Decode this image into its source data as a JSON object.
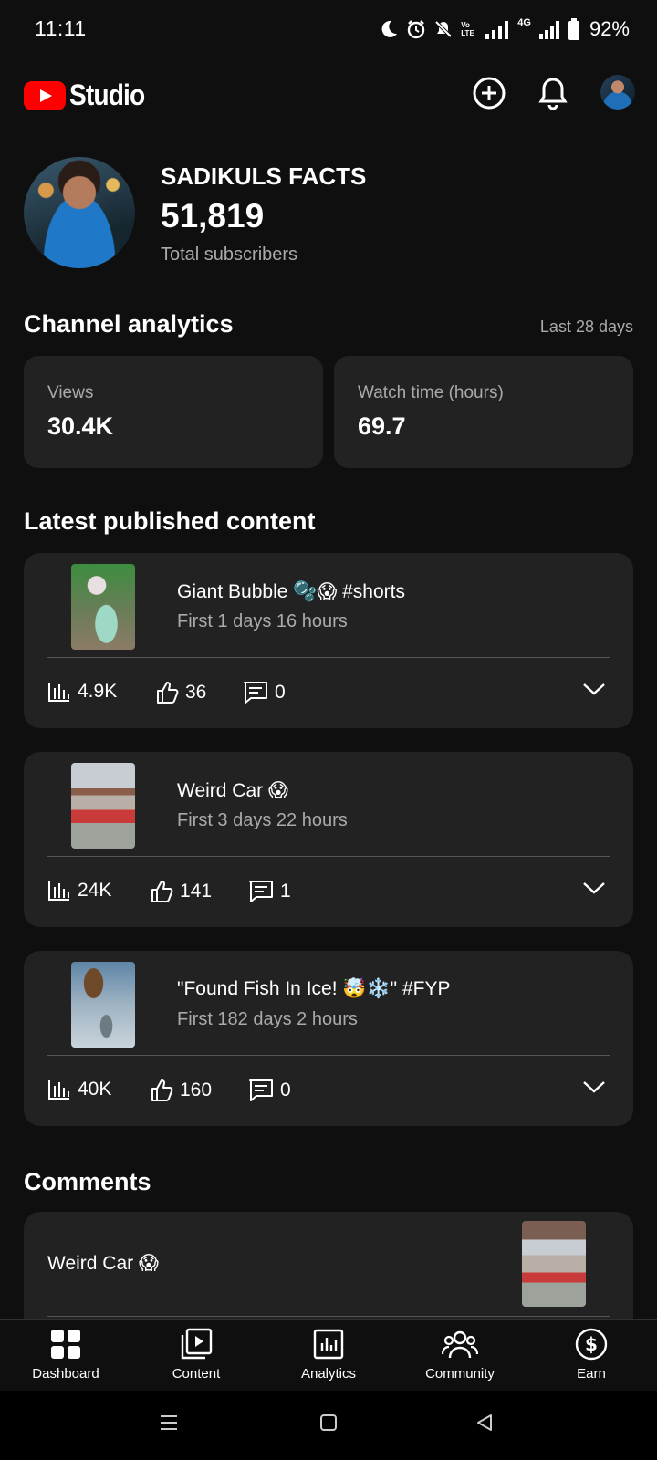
{
  "status_bar": {
    "time": "11:11",
    "battery": "92%",
    "network": "4G",
    "volte": "Vo LTE"
  },
  "header": {
    "app_name": "Studio",
    "icons": [
      "create-icon",
      "bell-icon",
      "account-avatar"
    ]
  },
  "channel": {
    "name": "SADIKULS FACTS",
    "subscribers": "51,819",
    "subscribers_label": "Total subscribers"
  },
  "analytics": {
    "title": "Channel analytics",
    "period": "Last 28 days",
    "views_label": "Views",
    "views_value": "30.4K",
    "watch_label": "Watch time (hours)",
    "watch_value": "69.7"
  },
  "latest": {
    "title": "Latest published content",
    "items": [
      {
        "title": "Giant Bubble 🫧😱 #shorts",
        "age": "First 1 days 16 hours",
        "views": "4.9K",
        "likes": "36",
        "comments": "0"
      },
      {
        "title": "Weird Car 😱",
        "age": "First 3 days 22 hours",
        "views": "24K",
        "likes": "141",
        "comments": "1"
      },
      {
        "title": "\"Found Fish In Ice! 🤯❄️\" #FYP",
        "age": "First 182 days 2 hours",
        "views": "40K",
        "likes": "160",
        "comments": "0"
      }
    ]
  },
  "comments": {
    "title": "Comments",
    "video_title": "Weird Car 😱"
  },
  "nav": {
    "items": [
      {
        "label": "Dashboard",
        "icon": "dashboard-icon"
      },
      {
        "label": "Content",
        "icon": "content-icon"
      },
      {
        "label": "Analytics",
        "icon": "analytics-icon"
      },
      {
        "label": "Community",
        "icon": "community-icon"
      },
      {
        "label": "Earn",
        "icon": "earn-icon"
      }
    ]
  },
  "colors": {
    "background": "#0f0f0f",
    "card": "#222222",
    "secondary_text": "#aaaaaa",
    "brand_red": "#ff0000"
  }
}
